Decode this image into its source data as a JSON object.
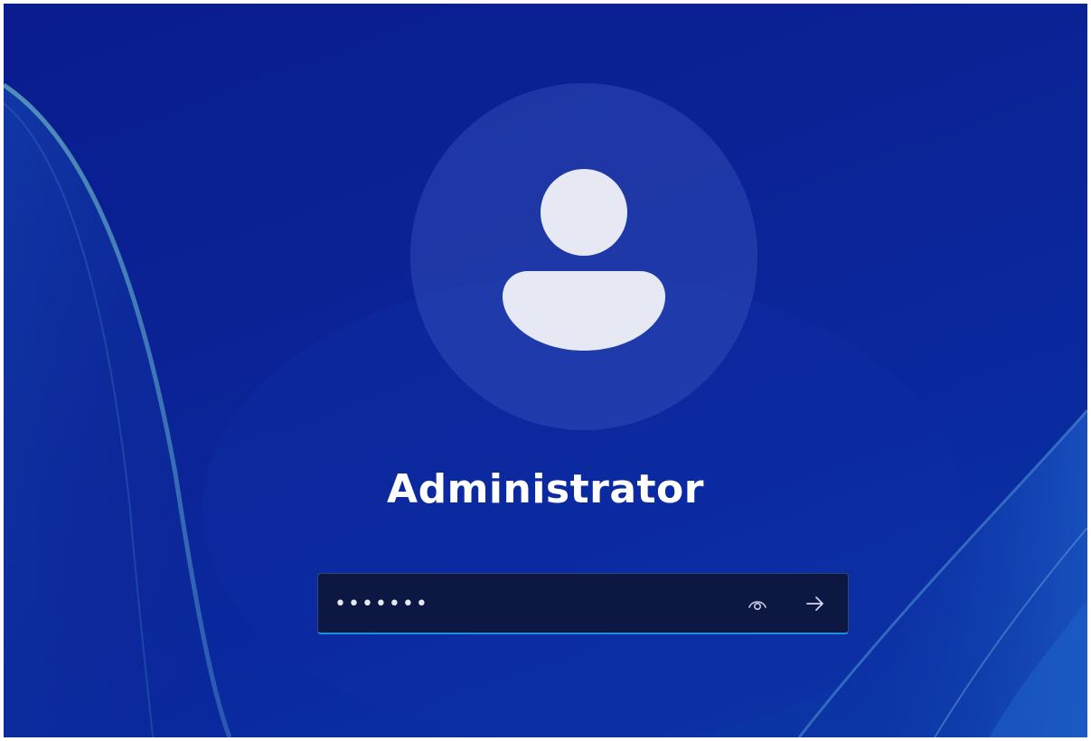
{
  "lock_screen": {
    "user": {
      "name": "Administrator",
      "avatar_icon": "user-silhouette-icon"
    },
    "password": {
      "value": "•••••••",
      "reveal_icon": "eye-icon",
      "submit_icon": "arrow-right-icon"
    }
  },
  "colors": {
    "background": "#0b2497",
    "accent": "#1d8fe0",
    "avatar_fill": "#e6e8f4",
    "input_background": "#0c1434"
  }
}
